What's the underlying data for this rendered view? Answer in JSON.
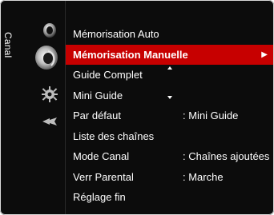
{
  "category": {
    "label": "Canal"
  },
  "icons": [
    {
      "name": "image-icon",
      "active": false
    },
    {
      "name": "channel-antenna-icon",
      "active": true
    },
    {
      "name": "setup-gear-icon",
      "active": false
    },
    {
      "name": "input-icon",
      "active": false
    }
  ],
  "menu": {
    "items": [
      {
        "label": "Mémorisation Auto",
        "value": ""
      },
      {
        "label": "Mémorisation Manuelle",
        "value": "",
        "selected": true,
        "arrow": "▶"
      },
      {
        "label": "Guide Complet",
        "value": ""
      },
      {
        "label": "Mini Guide",
        "value": ""
      },
      {
        "label": "Par défaut",
        "value": ": Mini Guide"
      },
      {
        "label": "Liste des chaînes",
        "value": ""
      },
      {
        "label": "Mode Canal",
        "value": ": Chaînes ajoutées"
      },
      {
        "label": "Verr Parental",
        "value": ": Marche"
      },
      {
        "label": "Réglage fin",
        "value": ""
      }
    ]
  },
  "colors": {
    "background": "#0c0c0c",
    "selection": "#c70000",
    "text": "#ffffff"
  }
}
